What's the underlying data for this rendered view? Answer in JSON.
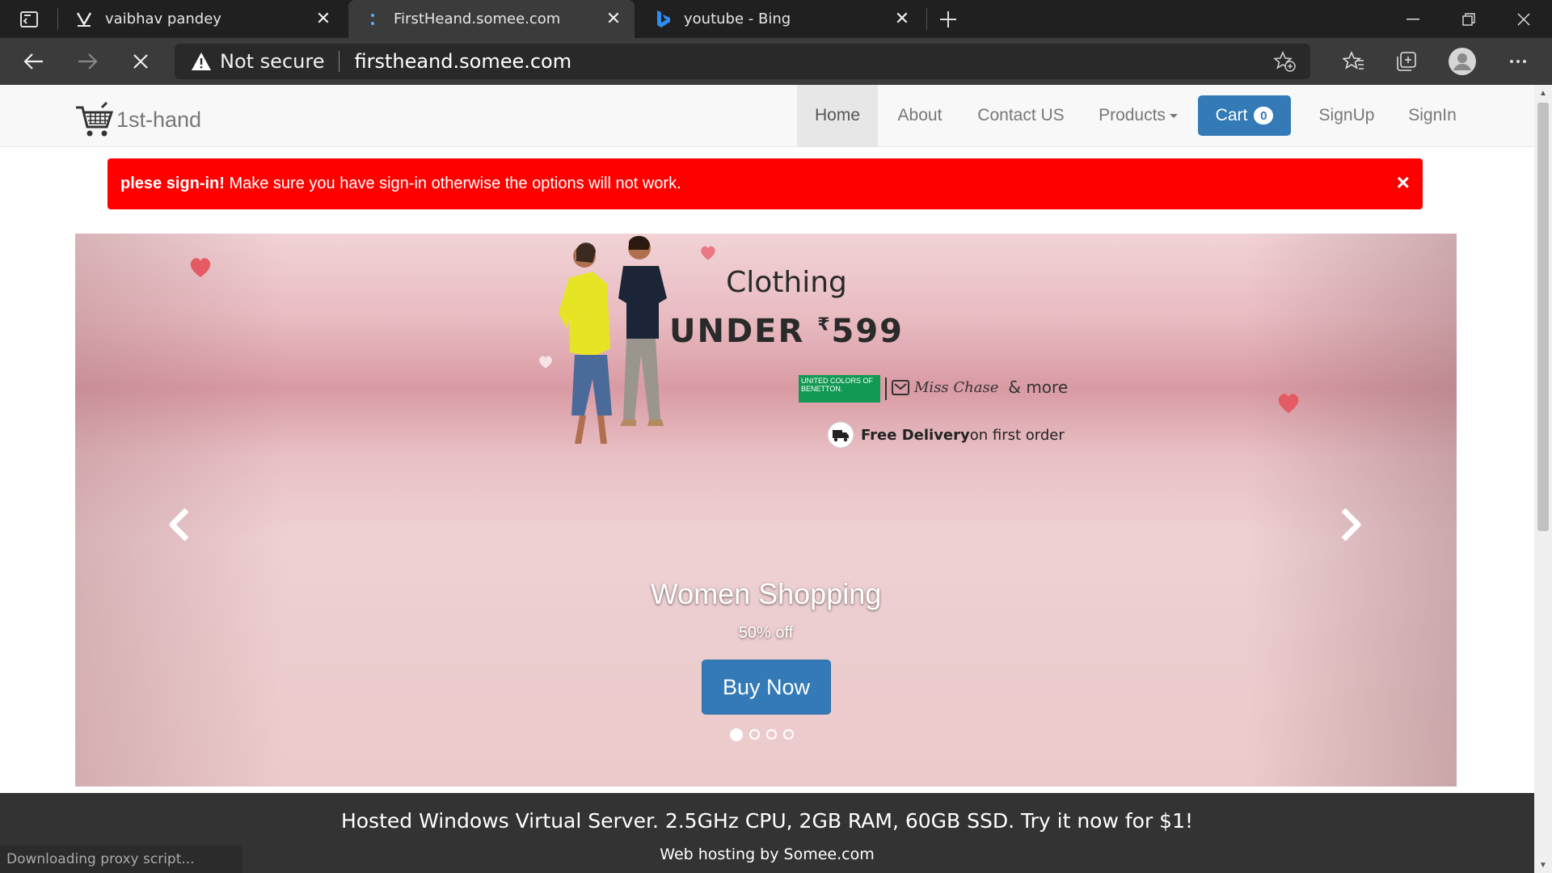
{
  "browser": {
    "tabs": [
      {
        "title": "vaibhav pandey",
        "favicon": "vaibhav-v-icon",
        "active": false
      },
      {
        "title": "FirstHeand.somee.com",
        "favicon": "loading-dots-icon",
        "active": true
      },
      {
        "title": "youtube - Bing",
        "favicon": "bing-icon",
        "active": false
      }
    ],
    "security_label": "Not secure",
    "url": "firstheand.somee.com",
    "status_text": "Downloading proxy script..."
  },
  "site": {
    "brand": "1st-hand",
    "nav": {
      "home": "Home",
      "about": "About",
      "contact": "Contact US",
      "products": "Products",
      "cart": "Cart",
      "cart_count": "0",
      "signup": "SignUp",
      "signin": "SignIn"
    },
    "alert": {
      "bold": "plese sign-in!",
      "text": " Make sure you have sign-in otherwise the options will not work.",
      "close": "×"
    },
    "carousel": {
      "promo_heading": "Clothing",
      "promo_price_prefix": "UNDER ",
      "promo_price_currency": "₹",
      "promo_price": "599",
      "brand_logo_text": "UNITED COLORS OF BENETTON.",
      "brand2": "Miss Chase",
      "brand_more": "& more",
      "delivery_bold": "Free Delivery",
      "delivery_text": " on first order",
      "caption_title": "Women Shopping",
      "caption_sub": "50% off",
      "button": "Buy Now",
      "slide_count": 4,
      "active_slide": 1
    },
    "hosting": {
      "line1": "Hosted Windows Virtual Server. 2.5GHz CPU, 2GB RAM, 60GB SSD. Try it now for $1!",
      "line2": "Web hosting by Somee.com"
    }
  },
  "colors": {
    "alert_red": "#ff0000",
    "primary_blue": "#337ab7",
    "browser_dark": "#202020"
  }
}
